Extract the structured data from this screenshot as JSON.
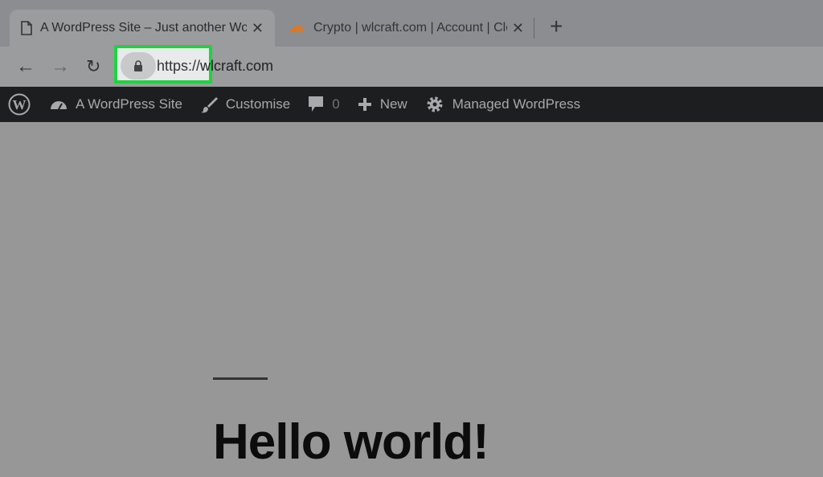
{
  "browser": {
    "tabs": [
      {
        "title": "A WordPress Site – Just another WordPress site",
        "icon": "page-icon",
        "active": true
      },
      {
        "title": "Crypto | wlcraft.com | Account | Cloudflare",
        "icon": "cloudflare-icon",
        "active": false
      }
    ],
    "url_scheme": "https://",
    "url_host": "wlcraft.com",
    "highlight_color": "#1fd33f"
  },
  "adminbar": {
    "site": "A WordPress Site",
    "customise": "Customise",
    "comments": "0",
    "new": "New",
    "managed": "Managed WordPress"
  },
  "post": {
    "title": "Hello world!"
  }
}
